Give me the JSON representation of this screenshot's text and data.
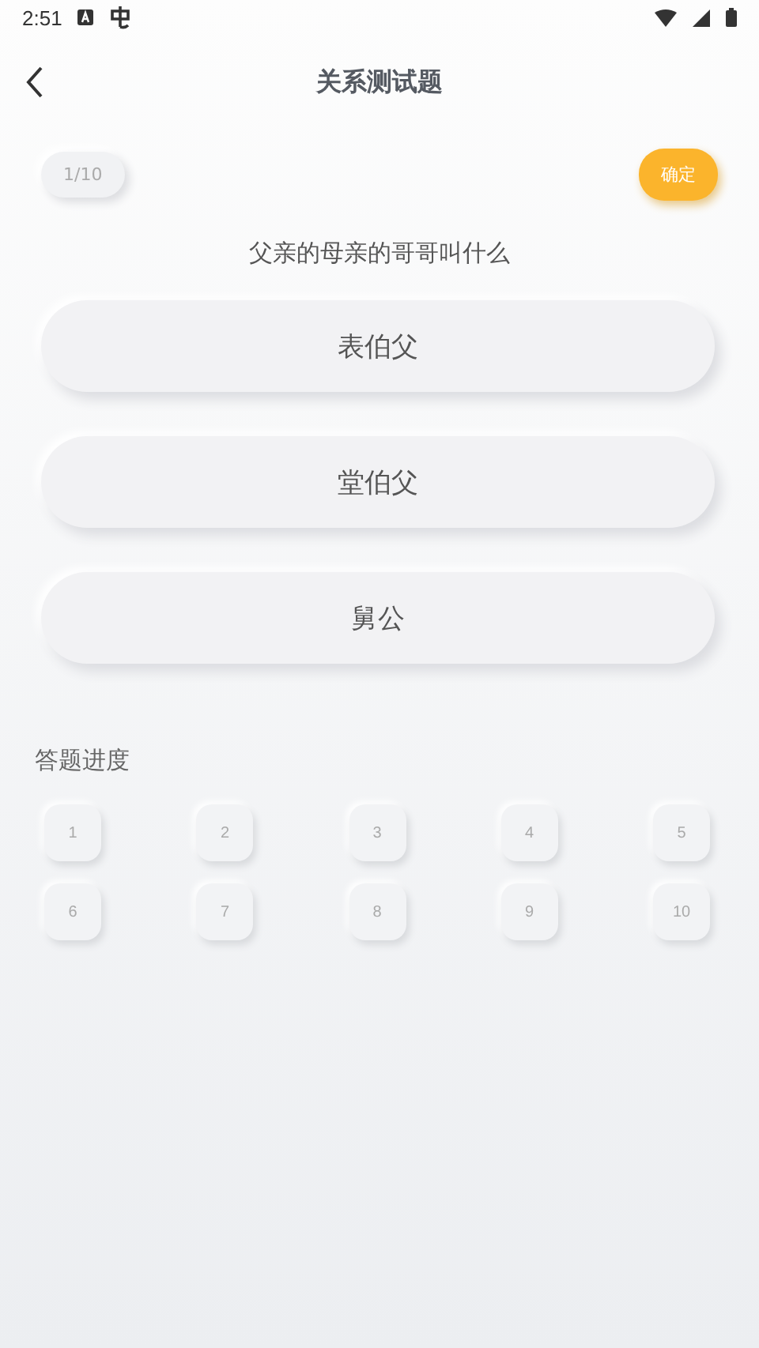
{
  "status_bar": {
    "time": "2:51"
  },
  "header": {
    "title": "关系测试题"
  },
  "quiz": {
    "counter": "1/10",
    "confirm": "确定",
    "question": "父亲的母亲的哥哥叫什么",
    "options": [
      {
        "label": "表伯父"
      },
      {
        "label": "堂伯父"
      },
      {
        "label": "舅公"
      }
    ]
  },
  "progress": {
    "title": "答题进度",
    "items": [
      "1",
      "2",
      "3",
      "4",
      "5",
      "6",
      "7",
      "8",
      "9",
      "10"
    ]
  }
}
